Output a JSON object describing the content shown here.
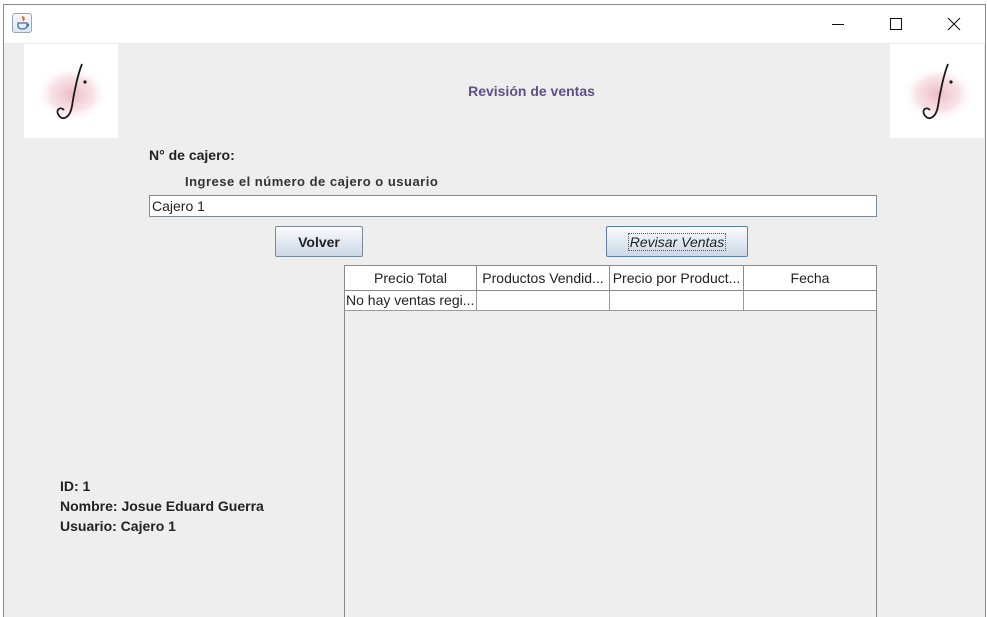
{
  "window": {
    "controls": {
      "minimize": "minimize-icon",
      "maximize": "maximize-icon",
      "close": "close-icon"
    }
  },
  "header": {
    "title": "Revisión de ventas"
  },
  "form": {
    "cajero_label": "N° de cajero:",
    "hint": "Ingrese el número de cajero o usuario",
    "cajero_value": "Cajero 1"
  },
  "buttons": {
    "volver": "Volver",
    "revisar": "Revisar Ventas"
  },
  "table": {
    "headers": [
      "Precio Total",
      "Productos Vendid...",
      "Precio por Product...",
      "Fecha"
    ],
    "rows": [
      [
        "No hay ventas regi...",
        "",
        "",
        ""
      ]
    ]
  },
  "user": {
    "id": "ID: 1",
    "nombre": "Nombre: Josue Eduard Guerra",
    "usuario": "Usuario: Cajero 1"
  },
  "colors": {
    "title": "#614e87",
    "panel": "#eeeeee"
  }
}
